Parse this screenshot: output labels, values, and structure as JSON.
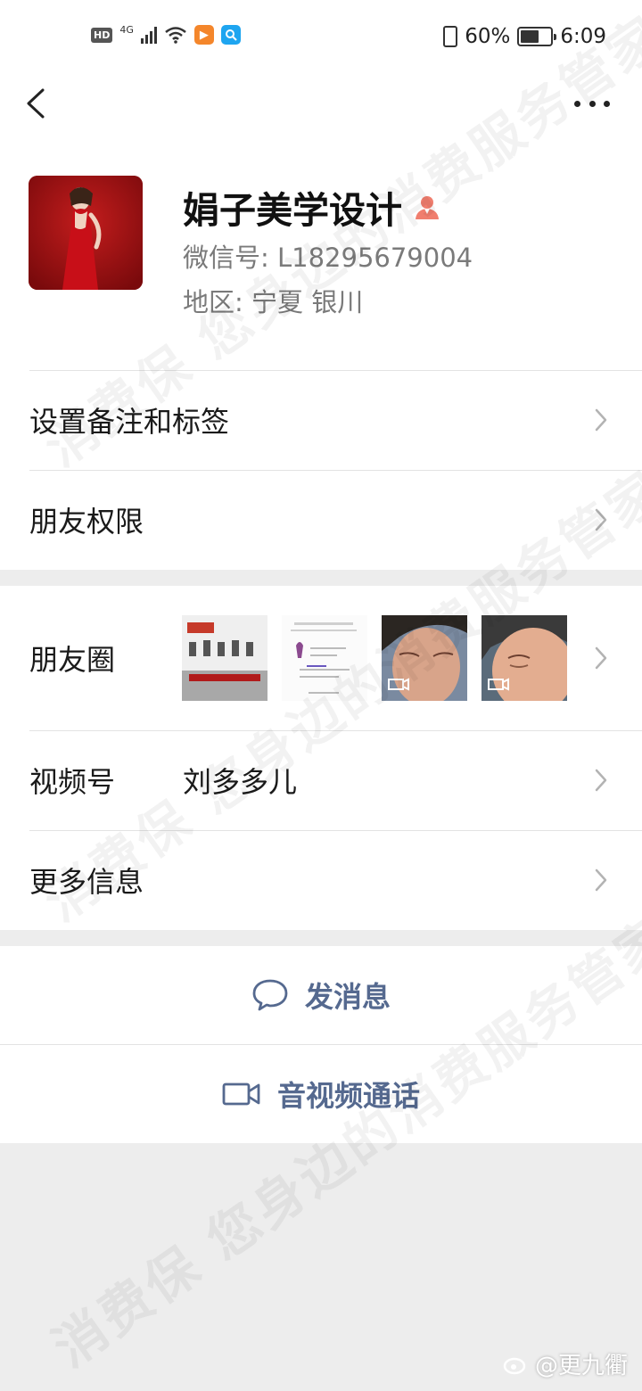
{
  "status_bar": {
    "network": "4G",
    "hd_badge": "HD",
    "battery": "60%",
    "battery_level": 0.6,
    "time": "6:09"
  },
  "nav": {
    "back_icon": "chevron-left-icon",
    "more_icon": "more-dots-icon"
  },
  "profile": {
    "name": "娟子美学设计",
    "gender_icon": "female-icon",
    "wechat_id": "微信号:  L18295679004",
    "region": "地区:  宁夏  银川"
  },
  "settings": {
    "remark_label": "设置备注和标签",
    "permission_label": "朋友权限"
  },
  "info": {
    "moments_label": "朋友圈",
    "channels_label": "视频号",
    "channels_value": "刘多多儿",
    "more_label": "更多信息"
  },
  "actions": {
    "message_label": "发消息",
    "message_icon": "chat-bubble-icon",
    "call_label": "音视频通话",
    "call_icon": "video-camera-icon"
  },
  "watermark": "消费保 您身边的消费服务管家",
  "credit": "@更九衢",
  "colors": {
    "accent": "#55698f",
    "background": "#ededed",
    "gender": "#f07e6e"
  }
}
